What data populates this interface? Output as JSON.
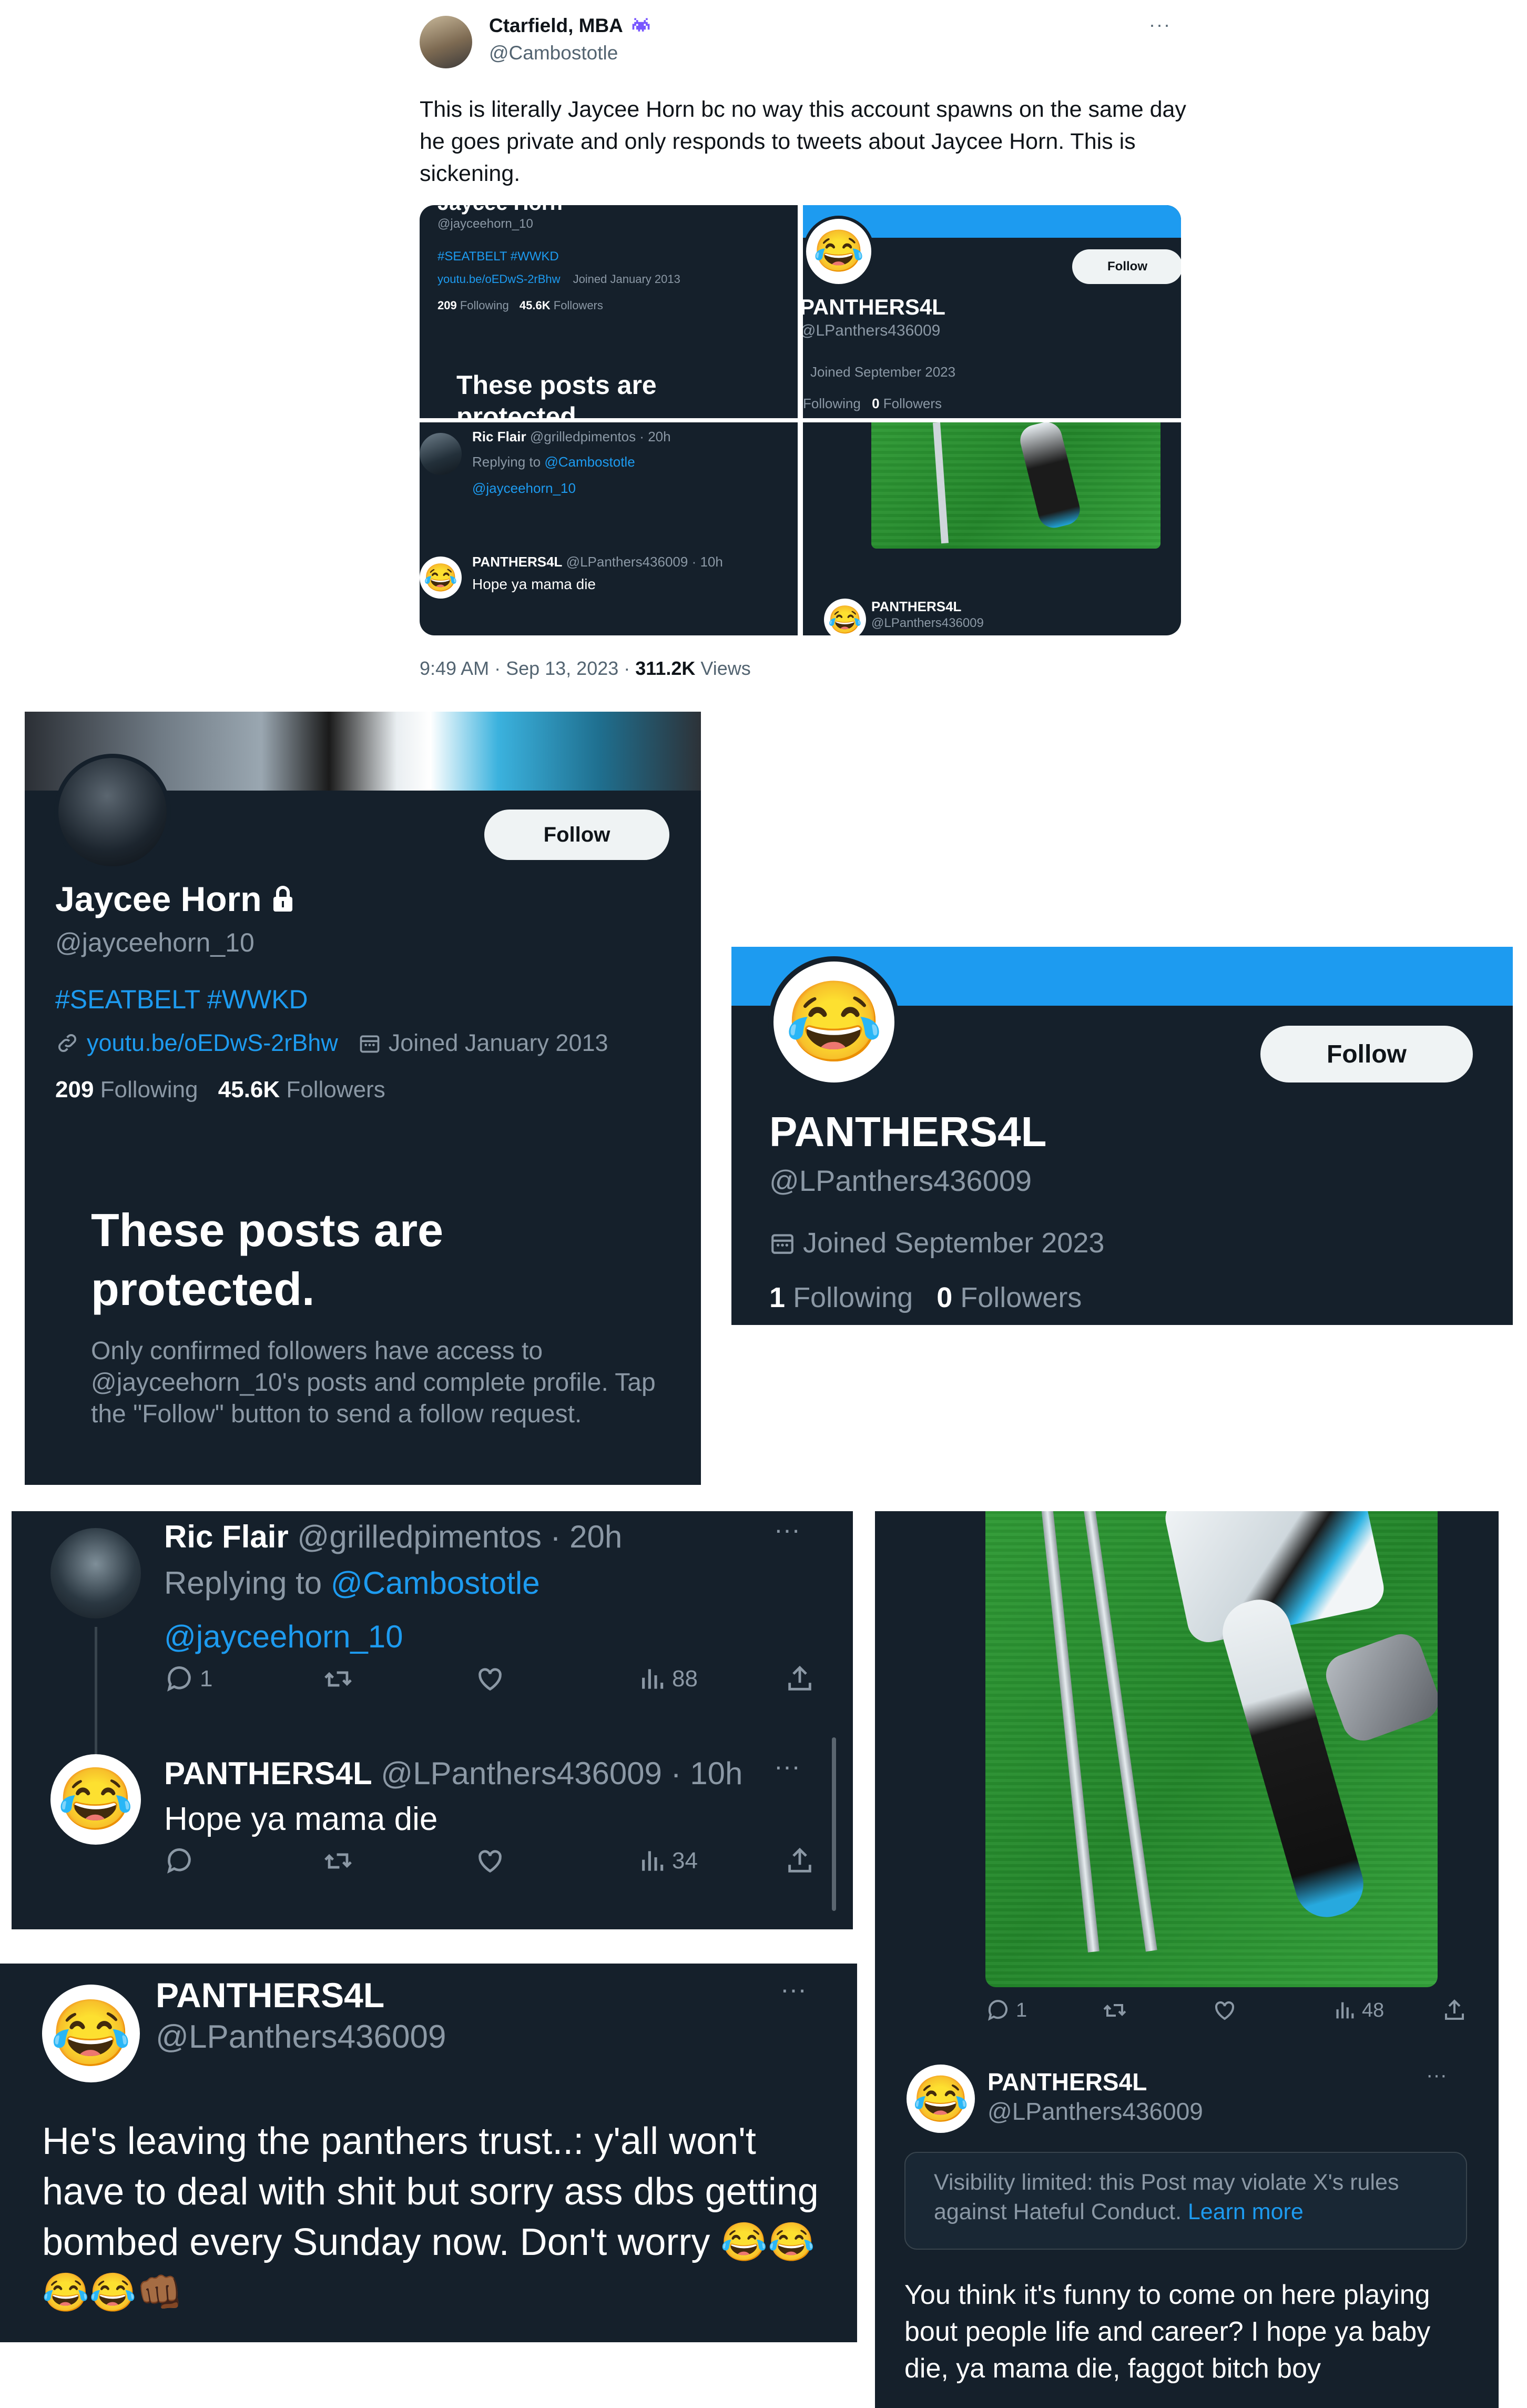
{
  "tweet": {
    "author_name": "Ctarfield, MBA",
    "author_handle": "@Cambostotle",
    "badge_icon": "space-invader-icon",
    "menu_label": "···",
    "text": "This is literally Jaycee Horn bc no way this account spawns on the same day he goes private and only responds to tweets about Jaycee Horn. This is sickening.",
    "time": "9:49 AM · Sep 13, 2023 · ",
    "views_count": "311.2K",
    "views_label": " Views"
  },
  "horn_profile": {
    "name": "Jaycee Horn",
    "handle": "@jayceehorn_10",
    "bio": "#SEATBELT #WWKD",
    "link": "youtu.be/oEDwS-2rBhw",
    "joined": "Joined January 2013",
    "following_count": "209",
    "following_label": "Following",
    "followers_count": "45.6K",
    "followers_label": "Followers",
    "follow_label": "Follow",
    "protected_title": "These posts are protected.",
    "protected_body": "Only confirmed followers have access to @jayceehorn_10's posts and complete profile. Tap the \"Follow\" button to send a follow request."
  },
  "panthers_profile": {
    "name": "PANTHERS4L",
    "handle": "@LPanthers436009",
    "joined": "Joined September 2023",
    "following_count": "1",
    "following_label": "Following",
    "followers_count": "0",
    "followers_label": "Followers",
    "follow_label": "Follow",
    "avatar_emoji": "😂"
  },
  "thread": {
    "reply1": {
      "name": "Ric Flair",
      "meta": "@grilledpimentos · 20h",
      "replying_label": "Replying to ",
      "replying_to": "@Cambostotle",
      "text": "@jayceehorn_10",
      "replies": "1",
      "views": "88"
    },
    "reply2": {
      "name": "PANTHERS4L",
      "meta": "@LPanthers436009 · 10h",
      "text": "Hope ya mama die",
      "views": "34"
    }
  },
  "panthers_post": {
    "name": "PANTHERS4L",
    "handle": "@LPanthers436009",
    "text": "He's leaving the panthers trust..: y'all won't have to deal with shit but sorry ass dbs getting bombed every Sunday now. Don't worry",
    "emojis": "😂😂😂😂👊🏾"
  },
  "image_post": {
    "replies": "1",
    "views": "48",
    "name": "PANTHERS4L",
    "handle": "@LPanthers436009",
    "notice": "Visibility limited: this Post may violate X's rules against Hateful Conduct. ",
    "notice_link": "Learn more",
    "text": "You think it's funny to come on here playing bout people life and career? I hope ya baby die, ya mama die, faggot bitch boy"
  },
  "colors": {
    "dark_bg": "#15202b",
    "accent_blue": "#1d9bf0",
    "muted_text": "#8b98a5"
  }
}
